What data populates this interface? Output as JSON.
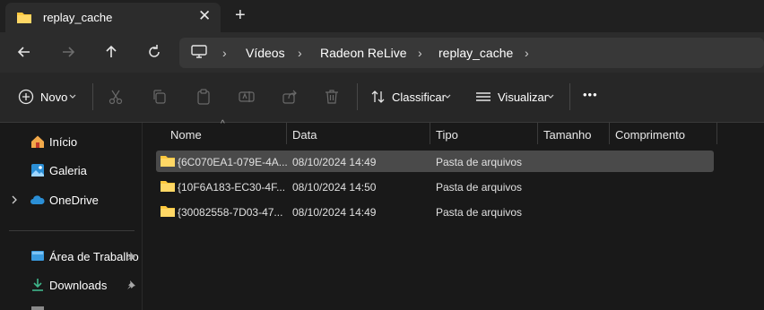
{
  "tab": {
    "title": "replay_cache",
    "close": "✕",
    "new_tab": "+"
  },
  "breadcrumb": {
    "sep": "›",
    "items": [
      "Vídeos",
      "Radeon ReLive",
      "replay_cache"
    ]
  },
  "toolbar": {
    "new_label": "Novo",
    "sort_label": "Classificar",
    "view_label": "Visualizar",
    "more": "•••"
  },
  "sidebar": {
    "items": [
      {
        "label": "Início",
        "icon": "home-icon"
      },
      {
        "label": "Galeria",
        "icon": "gallery-icon"
      },
      {
        "label": "OneDrive",
        "icon": "cloud-icon"
      },
      {
        "label": "Área de Trabalho",
        "icon": "desktop-icon"
      },
      {
        "label": "Downloads",
        "icon": "download-icon"
      }
    ]
  },
  "columns": [
    "Nome",
    "Data",
    "Tipo",
    "Tamanho",
    "Comprimento"
  ],
  "rows": [
    {
      "name": "{6C070EA1-079E-4A...",
      "date": "08/10/2024 14:49",
      "type": "Pasta de arquivos",
      "selected": true
    },
    {
      "name": "{10F6A183-EC30-4F...",
      "date": "08/10/2024 14:50",
      "type": "Pasta de arquivos",
      "selected": false
    },
    {
      "name": "{30082558-7D03-47...",
      "date": "08/10/2024 14:49",
      "type": "Pasta de arquivos",
      "selected": false
    }
  ],
  "colors": {
    "accent": "#ffc83d",
    "background": "#191919",
    "selection": "#4a4a4a"
  }
}
